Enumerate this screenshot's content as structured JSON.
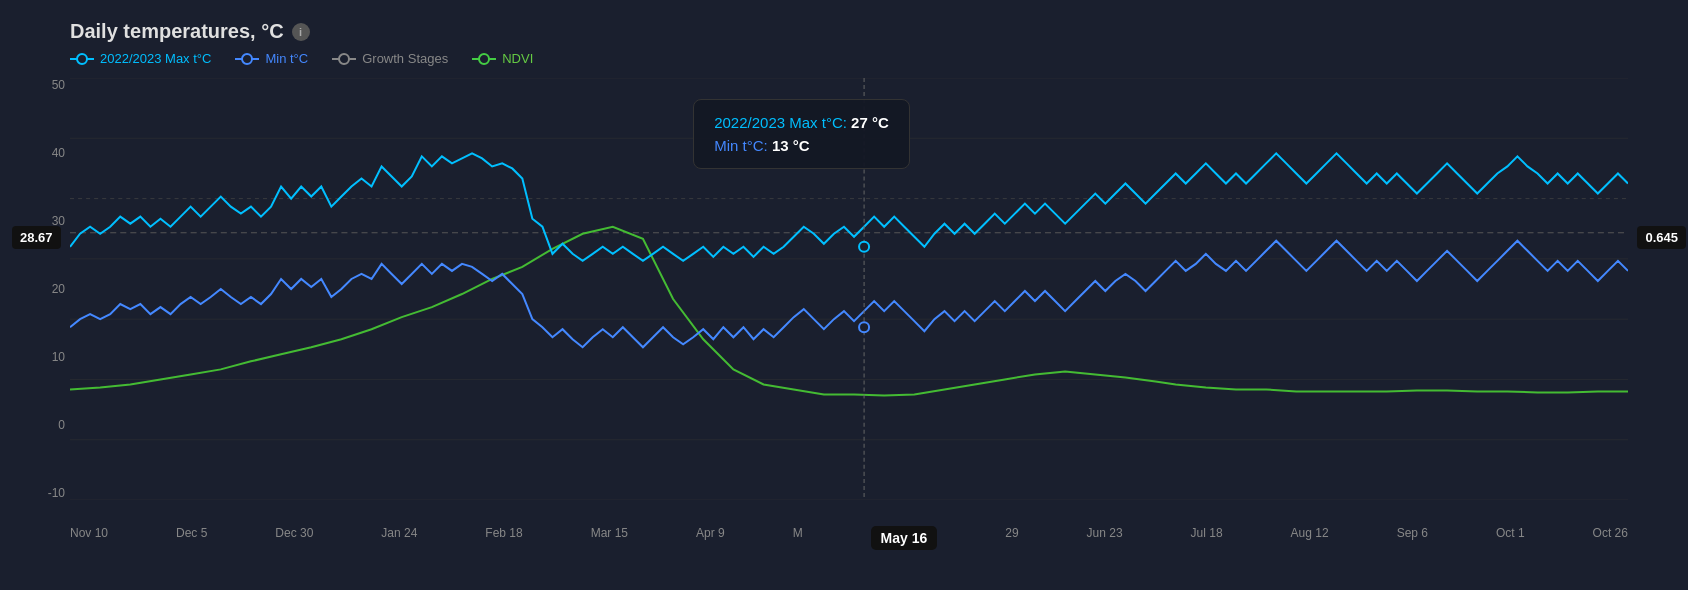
{
  "title": "Daily temperatures, °C",
  "legend": [
    {
      "id": "max-temp",
      "label": "2022/2023 Max t°C",
      "colorClass": "cyan"
    },
    {
      "id": "min-temp",
      "label": "Min t°C",
      "colorClass": "blue"
    },
    {
      "id": "growth",
      "label": "Growth Stages",
      "colorClass": "gray"
    },
    {
      "id": "ndvi",
      "label": "NDVI",
      "colorClass": "green"
    }
  ],
  "yAxis": {
    "labels": [
      "50",
      "40",
      "30",
      "20",
      "10",
      "0",
      "-10"
    ]
  },
  "xAxis": {
    "labels": [
      "Nov 10",
      "Dec 5",
      "Dec 30",
      "Jan 24",
      "Feb 18",
      "Mar 15",
      "Apr 9",
      "M",
      "May 16",
      "29",
      "Jun 23",
      "Jul 18",
      "Aug 12",
      "Sep 6",
      "Oct 1",
      "Oct 26"
    ]
  },
  "leftBadge": "28.67",
  "rightBadge": "0.645",
  "tooltip": {
    "maxLabel": "2022/2023 Max t°C:",
    "maxValue": "27 °C",
    "minLabel": "Min t°C:",
    "minValue": "13 °C"
  },
  "crosshairDate": "May 16",
  "infoIcon": "i"
}
